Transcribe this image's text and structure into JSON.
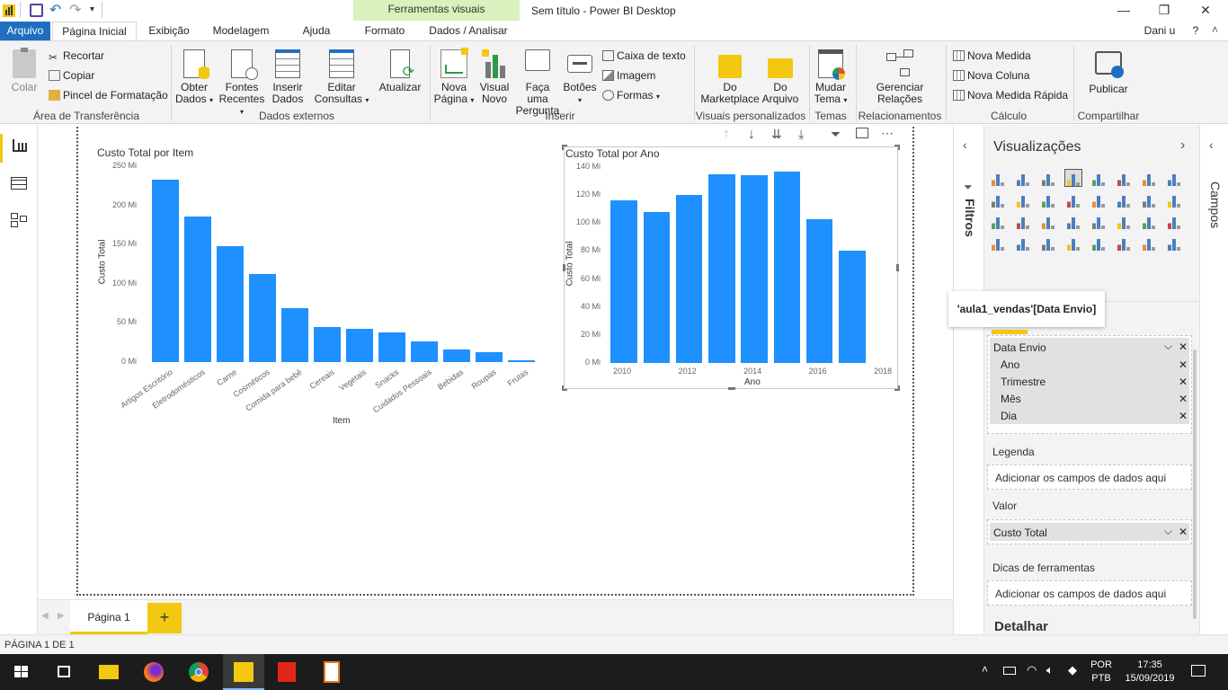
{
  "titlebar": {
    "context_tab": "Ferramentas visuais",
    "title": "Sem título - Power BI Desktop"
  },
  "menu": {
    "file": "Arquivo",
    "tabs": [
      "Página Inicial",
      "Exibição",
      "Modelagem",
      "Ajuda",
      "Formato",
      "Dados / Analisar"
    ],
    "user": "Dani u",
    "help": "?"
  },
  "ribbon": {
    "clipboard": {
      "paste": "Colar",
      "cut": "Recortar",
      "copy": "Copiar",
      "format_painter": "Pincel de Formatação",
      "group": "Área de Transferência"
    },
    "external": {
      "get1": "Obter",
      "get2": "Dados",
      "recent1": "Fontes",
      "recent2": "Recentes",
      "enter1": "Inserir",
      "enter2": "Dados",
      "edit1": "Editar",
      "edit2": "Consultas",
      "refresh": "Atualizar",
      "group": "Dados externos"
    },
    "insert": {
      "newpage1": "Nova",
      "newpage2": "Página",
      "newvisual1": "Visual",
      "newvisual2": "Novo",
      "ask1": "Faça uma",
      "ask2": "Pergunta",
      "buttons": "Botões",
      "textbox": "Caixa de texto",
      "image": "Imagem",
      "shapes": "Formas",
      "group": "Inserir"
    },
    "custom": {
      "market1": "Do",
      "market2": "Marketplace",
      "file1": "Do",
      "file2": "Arquivo",
      "group": "Visuais personalizados"
    },
    "themes": {
      "switch1": "Mudar",
      "switch2": "Tema",
      "group": "Temas"
    },
    "relations": {
      "manage1": "Gerenciar",
      "manage2": "Relações",
      "group": "Relacionamentos"
    },
    "calc": {
      "measure": "Nova Medida",
      "column": "Nova Coluna",
      "quick": "Nova Medida Rápida",
      "group": "Cálculo"
    },
    "share": {
      "publish": "Publicar",
      "group": "Compartilhar"
    }
  },
  "chart_data": [
    {
      "type": "bar",
      "title": "Custo Total por Item",
      "xlabel": "Item",
      "ylabel": "Custo Total",
      "y_ticks": [
        "250 Mi",
        "200 Mi",
        "150 Mi",
        "100 Mi",
        "50 Mi",
        "0 Mi"
      ],
      "ylim": [
        0,
        250
      ],
      "categories": [
        "Artigos Escritório",
        "Eletrodomésticos",
        "Carne",
        "Cosméticos",
        "Comida para bebê",
        "Cereais",
        "Vegetais",
        "Snacks",
        "Cuidados Pessoais",
        "Bebidas",
        "Roupas",
        "Frutas"
      ],
      "values": [
        233,
        186,
        148,
        112,
        69,
        45,
        43,
        38,
        26,
        16,
        13,
        2
      ],
      "color": "#1e90ff"
    },
    {
      "type": "bar",
      "title": "Custo Total por Ano",
      "xlabel": "Ano",
      "ylabel": "Custo Total",
      "y_ticks": [
        "140 Mi",
        "120 Mi",
        "100 Mi",
        "80 Mi",
        "60 Mi",
        "40 Mi",
        "20 Mi",
        "0 Mi"
      ],
      "ylim": [
        0,
        140
      ],
      "x_ticks": [
        "2010",
        "2012",
        "2014",
        "2016",
        "2018"
      ],
      "x": [
        2010,
        2011,
        2012,
        2013,
        2014,
        2015,
        2016,
        2017
      ],
      "values": [
        116,
        108,
        120,
        135,
        134,
        137,
        103,
        80
      ],
      "color": "#1e90ff"
    }
  ],
  "pagetabs": {
    "page1": "Página 1",
    "add": "+"
  },
  "status": {
    "page": "PÁGINA 1 DE 1"
  },
  "filters": {
    "label": "Filtros"
  },
  "viz": {
    "title": "Visualizações",
    "tooltip": "'aula1_vendas'[Data Envio]",
    "axis_field": "Data Envio",
    "axis_children": [
      "Ano",
      "Trimestre",
      "Mês",
      "Dia"
    ],
    "legend_label": "Legenda",
    "legend_placeholder": "Adicionar os campos de dados aqui",
    "value_label": "Valor",
    "value_field": "Custo Total",
    "tooltips_label": "Dicas de ferramentas",
    "tooltips_placeholder": "Adicionar os campos de dados aqui",
    "drill": "Detalhar"
  },
  "fields": {
    "label": "Campos"
  },
  "taskbar": {
    "lang1": "POR",
    "lang2": "PTB",
    "time": "17:35",
    "date": "15/09/2019"
  }
}
